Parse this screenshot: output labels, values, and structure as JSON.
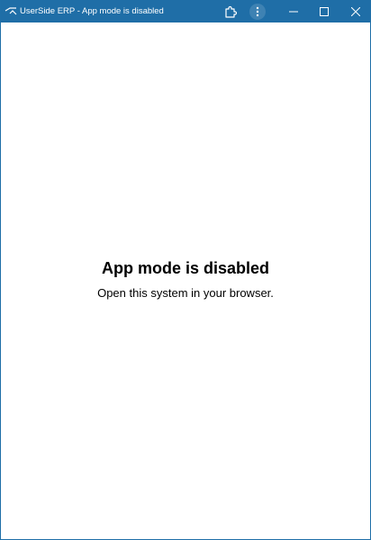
{
  "window": {
    "title": "UserSide ERP - App mode is disabled",
    "accent_color": "#1f6ea7"
  },
  "titlebar": {
    "app_icon": "userside-logo-icon",
    "extensions_icon": "puzzle-icon",
    "menu_icon": "vertical-dots-icon",
    "minimize_icon": "minimize-icon",
    "maximize_icon": "maximize-icon",
    "close_icon": "close-icon"
  },
  "content": {
    "heading": "App mode is disabled",
    "message": "Open this system in your browser."
  }
}
